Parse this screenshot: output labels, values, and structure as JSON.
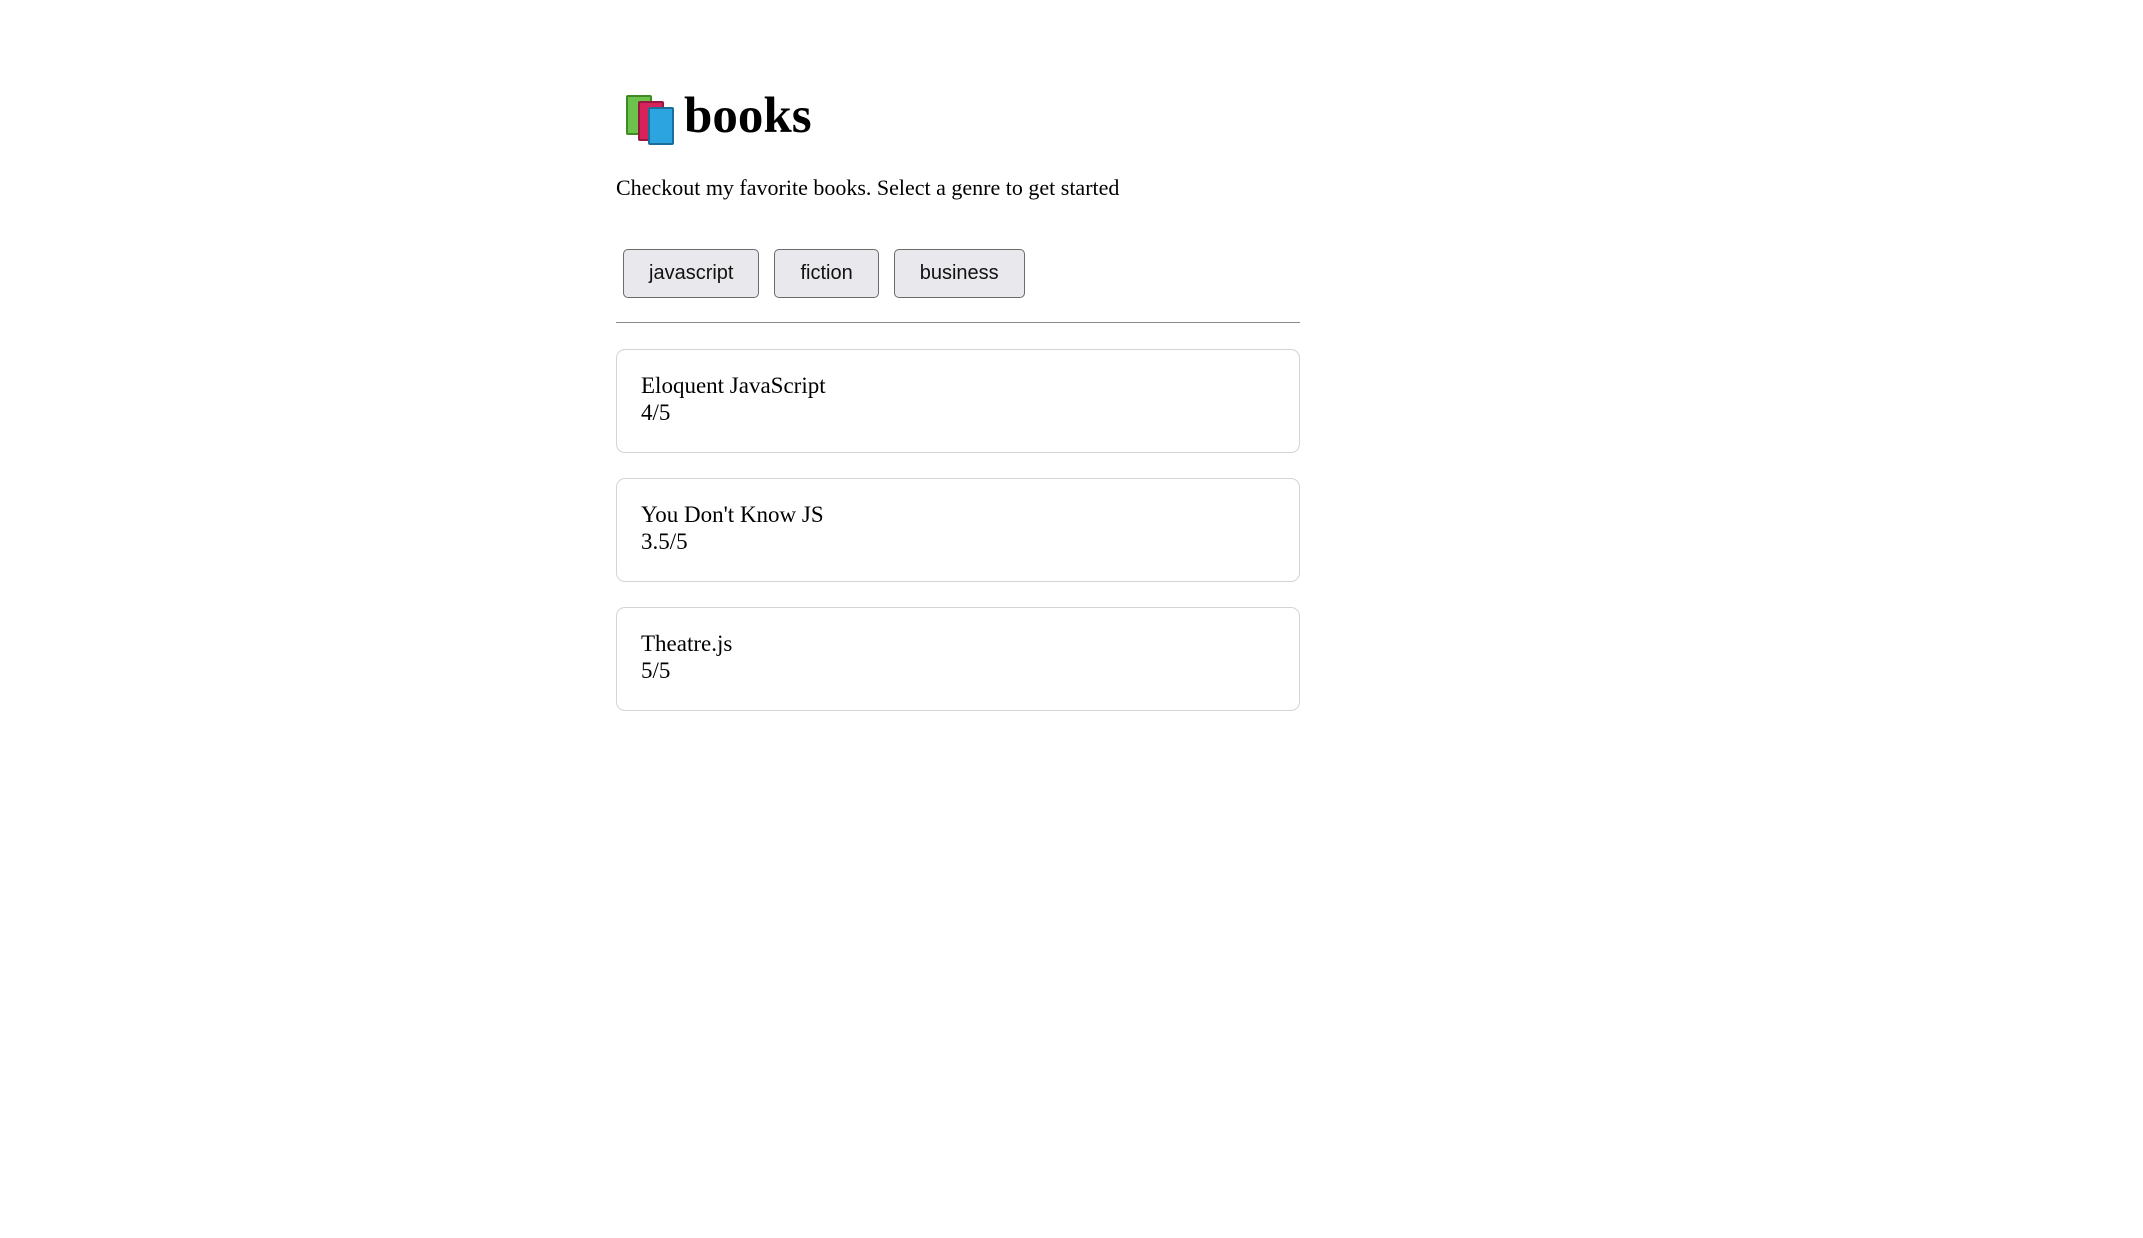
{
  "header": {
    "icon": "books-icon",
    "title": "books"
  },
  "intro_text": "Checkout my favorite books. Select a genre to get started",
  "genres": [
    {
      "label": "javascript"
    },
    {
      "label": "fiction"
    },
    {
      "label": "business"
    }
  ],
  "books": [
    {
      "name": "Eloquent JavaScript",
      "rating": "4/5"
    },
    {
      "name": "You Don't Know JS",
      "rating": "3.5/5"
    },
    {
      "name": "Theatre.js",
      "rating": "5/5"
    }
  ],
  "colors": {
    "button_bg": "#e9e9ed",
    "button_border": "#6b6b6b",
    "card_border": "#d4d4d4",
    "divider": "#8a8a8a"
  }
}
